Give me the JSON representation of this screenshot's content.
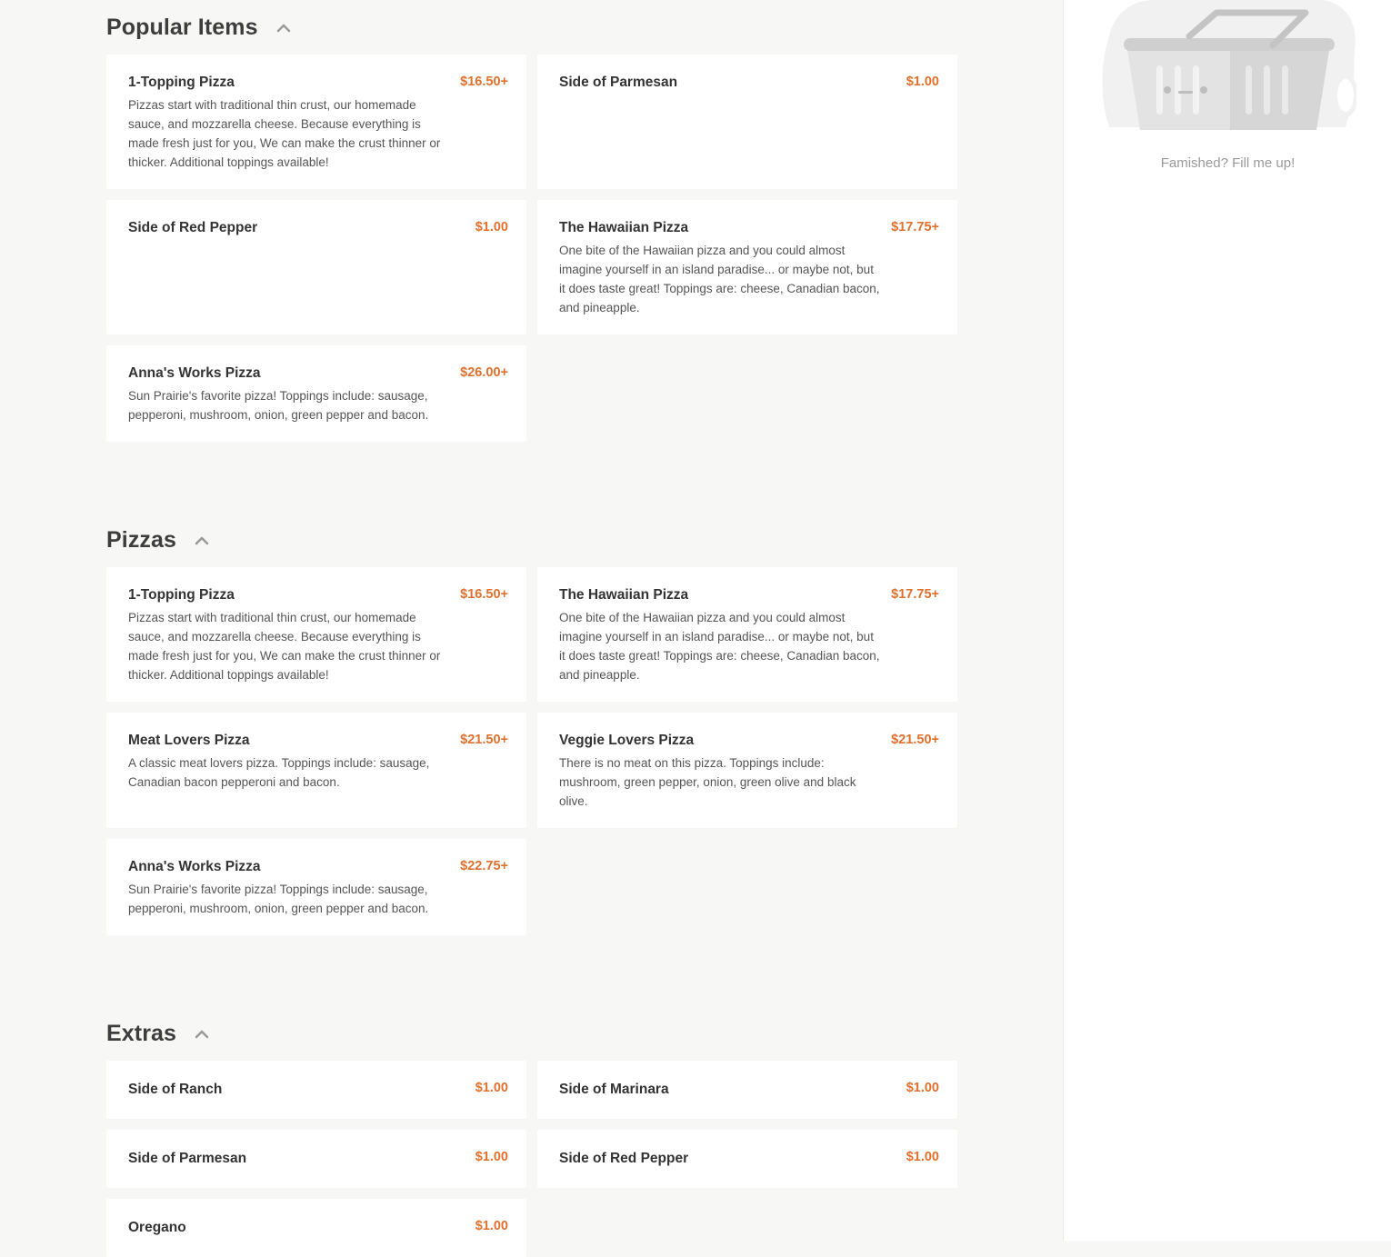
{
  "sections": [
    {
      "title": "Popular Items",
      "items": [
        {
          "name": "1-Topping Pizza",
          "price": "$16.50+",
          "desc": "Pizzas start with traditional thin crust, our homemade sauce, and mozzarella cheese. Because everything is made fresh just for you, We can make the crust thinner or thicker. Additional toppings available!"
        },
        {
          "name": "Side of Parmesan",
          "price": "$1.00",
          "desc": ""
        },
        {
          "name": "Side of Red Pepper",
          "price": "$1.00",
          "desc": ""
        },
        {
          "name": "The Hawaiian Pizza",
          "price": "$17.75+",
          "desc": "One bite of the Hawaiian pizza and you could almost imagine yourself in an island paradise... or maybe not, but it does taste great! Toppings are: cheese, Canadian bacon, and pineapple."
        },
        {
          "name": "Anna's Works Pizza",
          "price": "$26.00+",
          "desc": "Sun Prairie's favorite pizza! Toppings include: sausage, pepperoni, mushroom, onion, green pepper and bacon."
        }
      ]
    },
    {
      "title": "Pizzas",
      "items": [
        {
          "name": "1-Topping Pizza",
          "price": "$16.50+",
          "desc": "Pizzas start with traditional thin crust, our homemade sauce, and mozzarella cheese. Because everything is made fresh just for you, We can make the crust thinner or thicker. Additional toppings available!"
        },
        {
          "name": "The Hawaiian Pizza",
          "price": "$17.75+",
          "desc": "One bite of the Hawaiian pizza and you could almost imagine yourself in an island paradise... or maybe not, but it does taste great! Toppings are: cheese, Canadian bacon, and pineapple."
        },
        {
          "name": "Meat Lovers Pizza",
          "price": "$21.50+",
          "desc": "A classic meat lovers pizza. Toppings include: sausage, Canadian bacon pepperoni and bacon."
        },
        {
          "name": "Veggie Lovers Pizza",
          "price": "$21.50+",
          "desc": "There is no meat on this pizza. Toppings include: mushroom, green pepper, onion, green olive and black olive."
        },
        {
          "name": "Anna's Works Pizza",
          "price": "$22.75+",
          "desc": "Sun Prairie's favorite pizza! Toppings include: sausage, pepperoni, mushroom, onion, green pepper and bacon."
        }
      ]
    },
    {
      "title": "Extras",
      "items": [
        {
          "name": "Side of Ranch",
          "price": "$1.00",
          "desc": ""
        },
        {
          "name": "Side of Marinara",
          "price": "$1.00",
          "desc": ""
        },
        {
          "name": "Side of Parmesan",
          "price": "$1.00",
          "desc": ""
        },
        {
          "name": "Side of Red Pepper",
          "price": "$1.00",
          "desc": ""
        },
        {
          "name": "Oregano",
          "price": "$1.00",
          "desc": ""
        }
      ]
    }
  ],
  "cart": {
    "empty_message": "Famished? Fill me up!",
    "icon": "basket-icon"
  },
  "colors": {
    "accent": "#e0702d",
    "background": "#f7f7f6"
  }
}
